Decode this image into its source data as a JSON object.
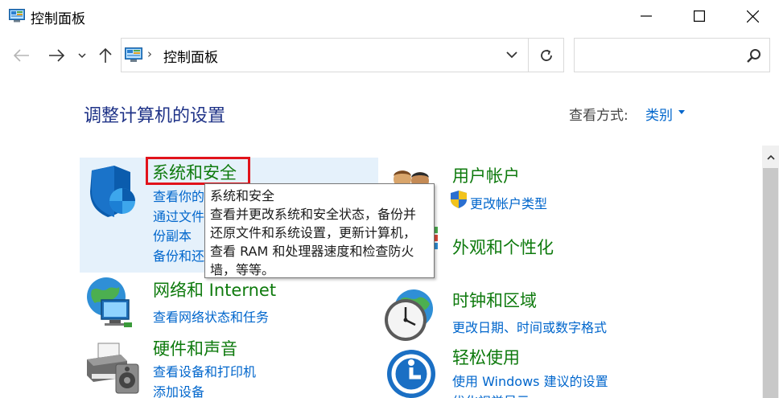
{
  "window": {
    "title": "控制面板"
  },
  "address_bar": {
    "separator": "›",
    "path": "控制面板"
  },
  "search": {
    "placeholder": ""
  },
  "main": {
    "title": "调整计算机的设置",
    "view_by_label": "查看方式:",
    "view_by_value": "类别"
  },
  "categories": [
    {
      "id": "system-security",
      "heading": "系统和安全",
      "links": [
        "查看你的",
        "通过文件",
        "份副本",
        "备份和还"
      ]
    },
    {
      "id": "network-internet",
      "heading": "网络和 Internet",
      "links": [
        "查看网络状态和任务"
      ]
    },
    {
      "id": "hardware-sound",
      "heading": "硬件和声音",
      "links": [
        "查看设备和打印机",
        "添加设备"
      ]
    },
    {
      "id": "user-accounts",
      "heading": "用户帐户",
      "links": [
        "更改帐户类型"
      ]
    },
    {
      "id": "appearance",
      "heading": "外观和个性化",
      "links": []
    },
    {
      "id": "clock-region",
      "heading": "时钟和区域",
      "links": [
        "更改日期、时间或数字格式"
      ]
    },
    {
      "id": "ease-of-access",
      "heading": "轻松使用",
      "links": [
        "使用 Windows 建议的设置",
        "优化视觉显示"
      ]
    }
  ],
  "tooltip": {
    "lines": [
      "系统和安全",
      "查看并更改系统和安全状态，备份并",
      "还原文件和系统设置，更新计算机，",
      "查看 RAM 和处理器速度和检查防火",
      "墙，等等。"
    ]
  },
  "colors": {
    "heading_green": "#0e7a0d",
    "link_blue": "#0066cc",
    "title_navy": "#1e3287",
    "highlight_bg": "#e5f1fb",
    "focus_red": "#e1131b"
  },
  "icons": {
    "window": "control-panel-icon",
    "back": "arrow-left-icon",
    "forward": "arrow-right-icon",
    "recent": "chevron-down-icon",
    "up": "arrow-up-icon",
    "dropdown": "chevron-down-icon",
    "refresh": "refresh-icon",
    "search": "search-icon"
  }
}
